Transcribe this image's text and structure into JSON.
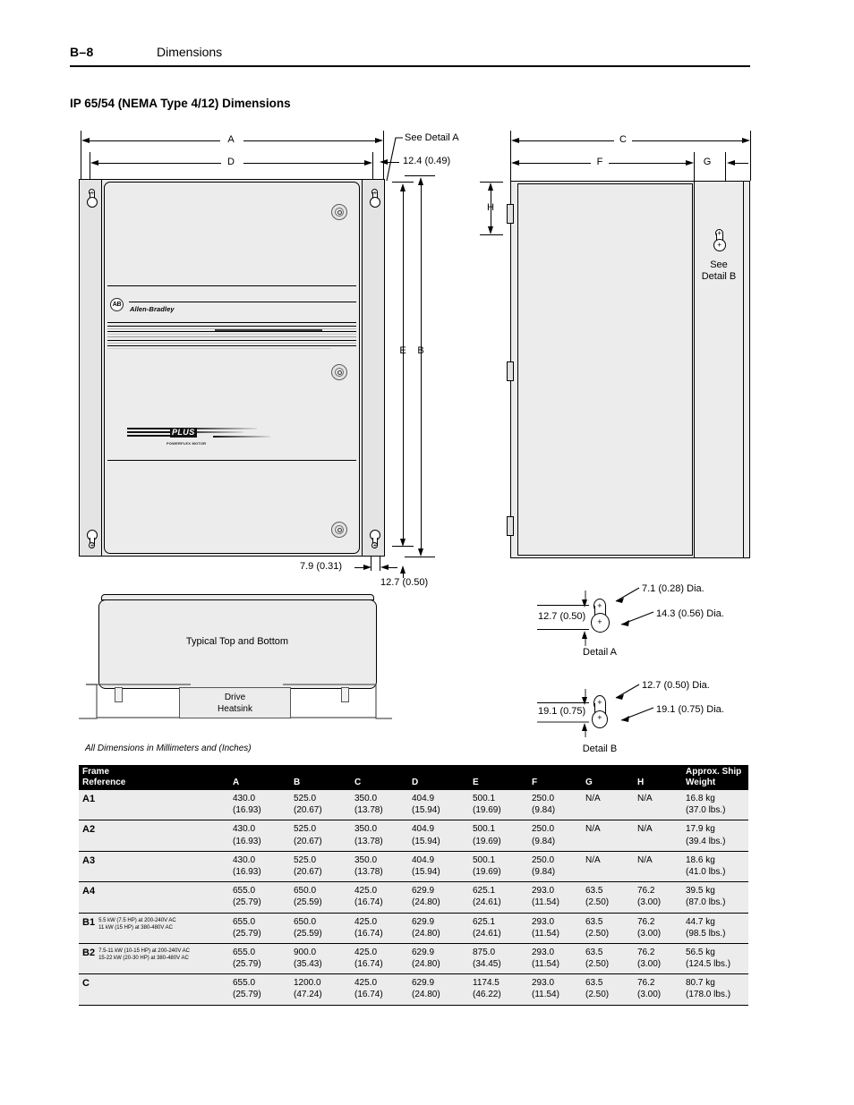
{
  "header": {
    "page_number": "B–8",
    "section": "Dimensions"
  },
  "title": "IP 65/54 (NEMA Type 4/12) Dimensions",
  "figure_note": "All Dimensions in Millimeters and (Inches)",
  "front_view": {
    "dim_a": "A",
    "dim_d": "D",
    "dim_e": "E",
    "dim_b": "B",
    "see_detail_a": "See Detail A",
    "top_gap": "12.4 (0.49)",
    "bottom_offset": "7.9 (0.31)",
    "bottom_gap": "12.7 (0.50)",
    "brand_logo": "AB",
    "brand_name": "Allen-Bradley",
    "product_mark": "PLUS",
    "product_sub": "POWERFLEX MOTOR"
  },
  "side_view": {
    "dim_c": "C",
    "dim_f": "F",
    "dim_g": "G",
    "dim_h": "H",
    "see_detail_b_line1": "See",
    "see_detail_b_line2": "Detail B"
  },
  "bottom_view": {
    "label": "Typical Top and Bottom",
    "heatsink_line1": "Drive",
    "heatsink_line2": "Heatsink"
  },
  "detail_a": {
    "caption": "Detail A",
    "spacing": "12.7 (0.50)",
    "top_dia": "7.1 (0.28) Dia.",
    "bottom_dia": "14.3 (0.56) Dia."
  },
  "detail_b": {
    "caption": "Detail B",
    "spacing": "19.1 (0.75)",
    "top_dia": "12.7 (0.50) Dia.",
    "bottom_dia": "19.1 (0.75) Dia."
  },
  "table": {
    "headers": {
      "frame_line1": "Frame",
      "frame_line2": "Reference",
      "a": "A",
      "b": "B",
      "c": "C",
      "d": "D",
      "e": "E",
      "f": "F",
      "g": "G",
      "h": "H",
      "weight_line1": "Approx. Ship",
      "weight_line2": "Weight"
    },
    "rows": [
      {
        "frame": "A1",
        "note": "",
        "a_mm": "430.0",
        "a_in": "(16.93)",
        "b_mm": "525.0",
        "b_in": "(20.67)",
        "c_mm": "350.0",
        "c_in": "(13.78)",
        "d_mm": "404.9",
        "d_in": "(15.94)",
        "e_mm": "500.1",
        "e_in": "(19.69)",
        "f_mm": "250.0",
        "f_in": "(9.84)",
        "g_mm": "N/A",
        "g_in": "",
        "h_mm": "N/A",
        "h_in": "",
        "w_kg": "16.8 kg",
        "w_lb": "(37.0 lbs.)"
      },
      {
        "frame": "A2",
        "note": "",
        "a_mm": "430.0",
        "a_in": "(16.93)",
        "b_mm": "525.0",
        "b_in": "(20.67)",
        "c_mm": "350.0",
        "c_in": "(13.78)",
        "d_mm": "404.9",
        "d_in": "(15.94)",
        "e_mm": "500.1",
        "e_in": "(19.69)",
        "f_mm": "250.0",
        "f_in": "(9.84)",
        "g_mm": "N/A",
        "g_in": "",
        "h_mm": "N/A",
        "h_in": "",
        "w_kg": "17.9 kg",
        "w_lb": "(39.4 lbs.)"
      },
      {
        "frame": "A3",
        "note": "",
        "a_mm": "430.0",
        "a_in": "(16.93)",
        "b_mm": "525.0",
        "b_in": "(20.67)",
        "c_mm": "350.0",
        "c_in": "(13.78)",
        "d_mm": "404.9",
        "d_in": "(15.94)",
        "e_mm": "500.1",
        "e_in": "(19.69)",
        "f_mm": "250.0",
        "f_in": "(9.84)",
        "g_mm": "N/A",
        "g_in": "",
        "h_mm": "N/A",
        "h_in": "",
        "w_kg": "18.6 kg",
        "w_lb": "(41.0 lbs.)"
      },
      {
        "frame": "A4",
        "note": "",
        "a_mm": "655.0",
        "a_in": "(25.79)",
        "b_mm": "650.0",
        "b_in": "(25.59)",
        "c_mm": "425.0",
        "c_in": "(16.74)",
        "d_mm": "629.9",
        "d_in": "(24.80)",
        "e_mm": "625.1",
        "e_in": "(24.61)",
        "f_mm": "293.0",
        "f_in": "(11.54)",
        "g_mm": "63.5",
        "g_in": "(2.50)",
        "h_mm": "76.2",
        "h_in": "(3.00)",
        "w_kg": "39.5 kg",
        "w_lb": "(87.0 lbs.)"
      },
      {
        "frame": "B1",
        "note_line1": "5.5 kW (7.5 HP) at 200-240V AC",
        "note_line2": "11 kW (15 HP) at 380-480V AC",
        "a_mm": "655.0",
        "a_in": "(25.79)",
        "b_mm": "650.0",
        "b_in": "(25.59)",
        "c_mm": "425.0",
        "c_in": "(16.74)",
        "d_mm": "629.9",
        "d_in": "(24.80)",
        "e_mm": "625.1",
        "e_in": "(24.61)",
        "f_mm": "293.0",
        "f_in": "(11.54)",
        "g_mm": "63.5",
        "g_in": "(2.50)",
        "h_mm": "76.2",
        "h_in": "(3.00)",
        "w_kg": "44.7 kg",
        "w_lb": "(98.5 lbs.)"
      },
      {
        "frame": "B2",
        "note_line1": "7.5-11 kW (10-15 HP) at 200-240V AC",
        "note_line2": "15-22 kW (20-30 HP) at 380-480V AC",
        "a_mm": "655.0",
        "a_in": "(25.79)",
        "b_mm": "900.0",
        "b_in": "(35.43)",
        "c_mm": "425.0",
        "c_in": "(16.74)",
        "d_mm": "629.9",
        "d_in": "(24.80)",
        "e_mm": "875.0",
        "e_in": "(34.45)",
        "f_mm": "293.0",
        "f_in": "(11.54)",
        "g_mm": "63.5",
        "g_in": "(2.50)",
        "h_mm": "76.2",
        "h_in": "(3.00)",
        "w_kg": "56.5 kg",
        "w_lb": "(124.5 lbs.)"
      },
      {
        "frame": "C",
        "note": "",
        "a_mm": "655.0",
        "a_in": "(25.79)",
        "b_mm": "1200.0",
        "b_in": "(47.24)",
        "c_mm": "425.0",
        "c_in": "(16.74)",
        "d_mm": "629.9",
        "d_in": "(24.80)",
        "e_mm": "1174.5",
        "e_in": "(46.22)",
        "f_mm": "293.0",
        "f_in": "(11.54)",
        "g_mm": "63.5",
        "g_in": "(2.50)",
        "h_mm": "76.2",
        "h_in": "(3.00)",
        "w_kg": "80.7 kg",
        "w_lb": "(178.0 lbs.)"
      }
    ]
  }
}
